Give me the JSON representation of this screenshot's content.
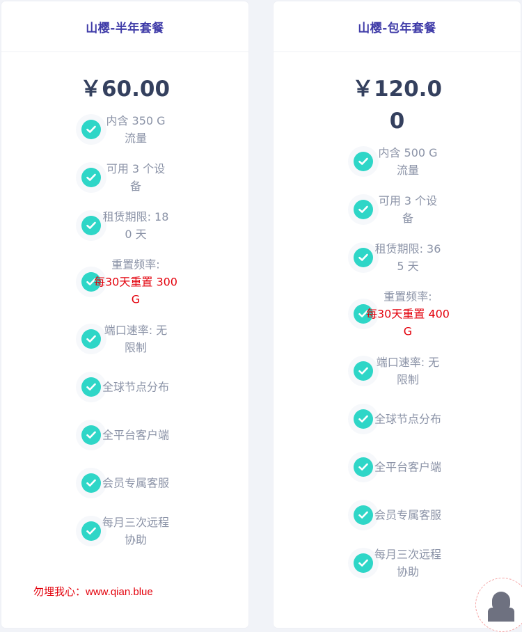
{
  "plans": [
    {
      "title": "山樱-半年套餐",
      "price": "￥60.00",
      "features": [
        {
          "text": "内含 350 G 流量"
        },
        {
          "text": "可用 3 个设备"
        },
        {
          "text": "租赁期限: 180 天"
        },
        {
          "text": "重置频率:",
          "highlight": "每30天重置 300G"
        },
        {
          "text": "端口速率: 无限制"
        },
        {
          "text": "全球节点分布"
        },
        {
          "text": "全平台客户端"
        },
        {
          "text": "会员专属客服"
        },
        {
          "text": "每月三次远程协助"
        }
      ]
    },
    {
      "title": "山樱-包年套餐",
      "price": "￥120.00",
      "features": [
        {
          "text": "内含 500 G 流量"
        },
        {
          "text": "可用 3 个设备"
        },
        {
          "text": "租赁期限: 365 天"
        },
        {
          "text": "重置频率:",
          "highlight": "每30天重置 400G"
        },
        {
          "text": "端口速率: 无限制"
        },
        {
          "text": "全球节点分布"
        },
        {
          "text": "全平台客户端"
        },
        {
          "text": "会员专属客服"
        },
        {
          "text": "每月三次远程协助"
        }
      ]
    }
  ],
  "watermark": "勿埋我心：www.qian.blue",
  "support_icon": "customer-service-avatar-icon",
  "colors": {
    "title": "#3f3ba8",
    "price": "#34405e",
    "check": "#2ed6c7",
    "feature_text": "#8b93a7",
    "highlight": "#e3000b",
    "background": "#f1f3f8"
  }
}
